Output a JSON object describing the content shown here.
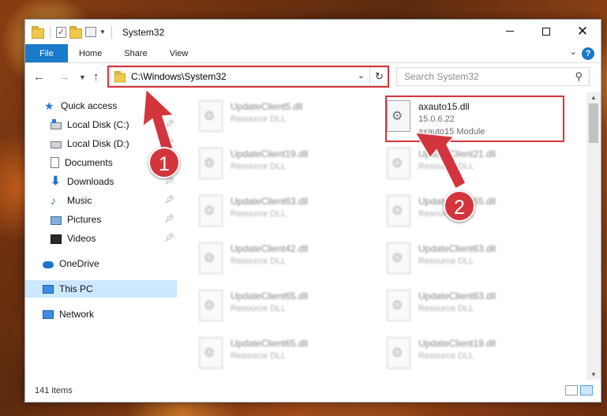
{
  "window": {
    "title": "System32"
  },
  "ribbon": {
    "file": "File",
    "tabs": [
      "Home",
      "Share",
      "View"
    ],
    "help": "?"
  },
  "address": {
    "path": "C:\\Windows\\System32"
  },
  "search": {
    "placeholder": "Search System32"
  },
  "sidebar": {
    "items": [
      {
        "label": "Quick access",
        "icon": "star-icon",
        "pinned": false
      },
      {
        "label": "Local Disk (C:)",
        "icon": "drive-icon",
        "pinned": true
      },
      {
        "label": "Local Disk (D:)",
        "icon": "drive-icon",
        "pinned": true
      },
      {
        "label": "Documents",
        "icon": "documents-icon",
        "pinned": true
      },
      {
        "label": "Downloads",
        "icon": "downloads-icon",
        "pinned": true
      },
      {
        "label": "Music",
        "icon": "music-icon",
        "pinned": true
      },
      {
        "label": "Pictures",
        "icon": "pictures-icon",
        "pinned": true
      },
      {
        "label": "Videos",
        "icon": "videos-icon",
        "pinned": true
      },
      {
        "label": "OneDrive",
        "icon": "onedrive-icon",
        "pinned": false
      },
      {
        "label": "This PC",
        "icon": "this-pc-icon",
        "pinned": false,
        "selected": true
      },
      {
        "label": "Network",
        "icon": "network-icon",
        "pinned": false
      }
    ]
  },
  "files": {
    "left": [
      {
        "name": "UpdateClient5.dll",
        "type": "Resource DLL"
      },
      {
        "name": "UpdateClient19.dll",
        "type": "Resource DLL"
      },
      {
        "name": "UpdateClient63.dll",
        "type": "Resource DLL"
      },
      {
        "name": "UpdateClient42.dll",
        "type": "Resource DLL"
      },
      {
        "name": "UpdateClient65.dll",
        "type": "Resource DLL"
      },
      {
        "name": "UpdateClient65.dll",
        "type": "Resource DLL"
      }
    ],
    "right": [
      {
        "name": "UpdateClient21.dll",
        "type": "Resource DLL"
      },
      {
        "name": "UpdateClient65.dll",
        "type": "Resource DLL"
      },
      {
        "name": "UpdateClient63.dll",
        "type": "Resource DLL"
      },
      {
        "name": "UpdateClient63.dll",
        "type": "Resource DLL"
      },
      {
        "name": "UpdateClient19.dll",
        "type": "Resource DLL"
      }
    ],
    "highlighted": {
      "name": "axauto15.dll",
      "version": "15.0.6.22",
      "description": "axauto15 Module"
    }
  },
  "status": {
    "count": "141 items"
  },
  "annotations": {
    "step1": "1",
    "step2": "2",
    "color": "#d4353c"
  }
}
